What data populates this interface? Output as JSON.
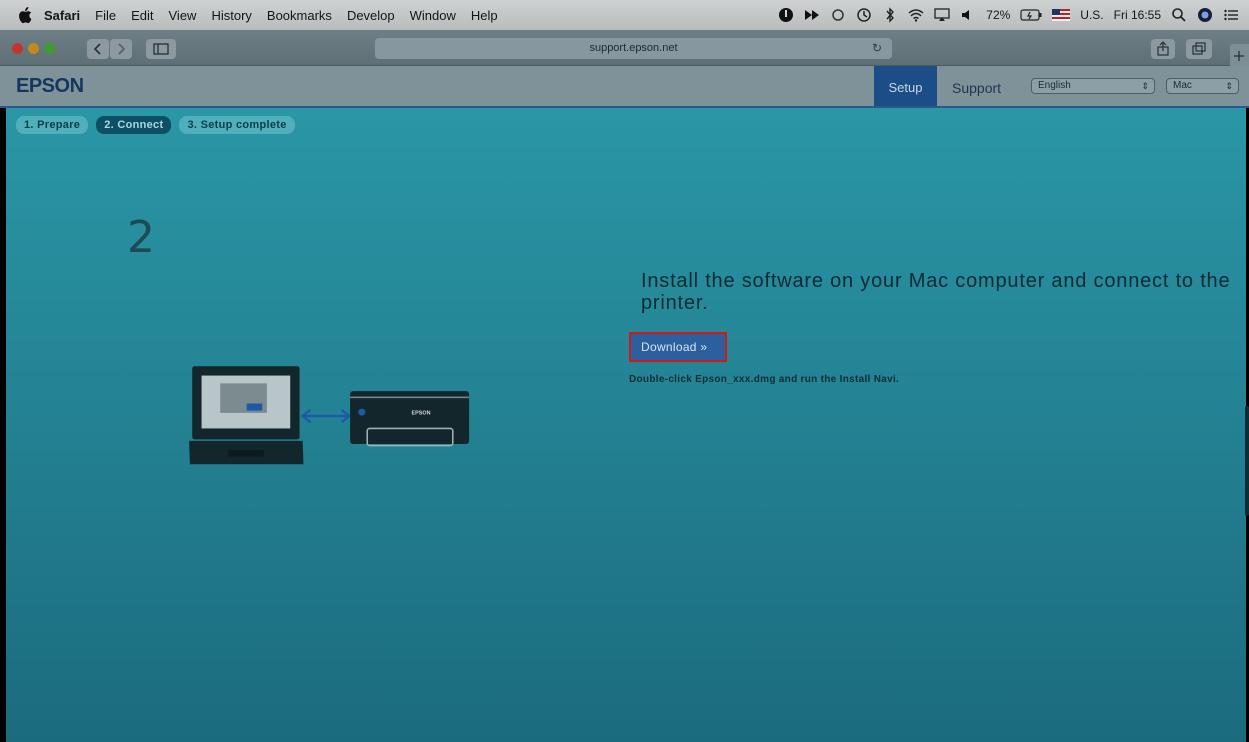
{
  "menubar": {
    "items": [
      "Safari",
      "File",
      "Edit",
      "View",
      "History",
      "Bookmarks",
      "Develop",
      "Window",
      "Help"
    ],
    "battery": "72%",
    "input_source": "U.S.",
    "clock": "Fri 16:55"
  },
  "browser": {
    "url": "support.epson.net"
  },
  "header": {
    "logo": "EPSON",
    "nav_setup": "Setup",
    "nav_support": "Support",
    "language_select": "English",
    "os_select": "Mac"
  },
  "steps": [
    {
      "label": "1. Prepare",
      "active": false
    },
    {
      "label": "2. Connect",
      "active": true
    },
    {
      "label": "3. Setup complete",
      "active": false
    }
  ],
  "main": {
    "step_number": "2",
    "printer_label": "EPSON",
    "headline": "Install the software on your Mac computer and connect to the printer.",
    "download_label": "Download »",
    "hint": "Double-click Epson_xxx.dmg and run the Install Navi."
  },
  "colors": {
    "page_bg": "#227f90",
    "highlight_border": "#d01a1a",
    "button_bg": "#2b5f9e",
    "nav_active": "#1b4e86"
  }
}
